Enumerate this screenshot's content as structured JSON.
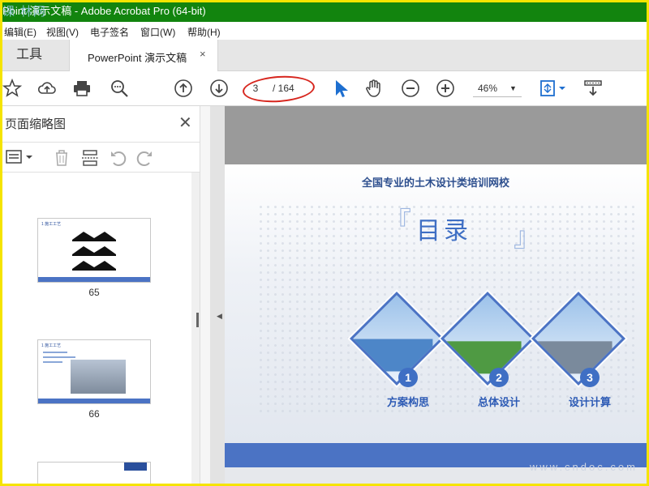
{
  "window": {
    "title": "Point 演示文稿 - Adobe Acrobat Pro (64-bit)",
    "watermark": "课 林网"
  },
  "menu": [
    "编辑(E)",
    "视图(V)",
    "电子签名",
    "窗口(W)",
    "帮助(H)"
  ],
  "tabs": {
    "tools": "工具",
    "document": "PowerPoint 演示文稿",
    "close": "×"
  },
  "toolbar": {
    "current_page": "3",
    "total_pages": "/ 164",
    "zoom": "46%",
    "zoom_arrow": "▼"
  },
  "panel": {
    "title": "页面缩略图",
    "close": "✕",
    "collapse": "◀"
  },
  "thumbnails": [
    {
      "page": "65",
      "heading": "1 施工工艺"
    },
    {
      "page": "66",
      "heading": "1 施工工艺"
    }
  ],
  "slide": {
    "title": "全国专业的土木设计类培训网校",
    "heading": "目录",
    "open_bracket": "『",
    "close_bracket": "』",
    "items": [
      {
        "number": "1",
        "label": "方案构思"
      },
      {
        "number": "2",
        "label": "总体设计"
      },
      {
        "number": "3",
        "label": "设计计算"
      }
    ],
    "watermark": "www.cndoc.com"
  },
  "colors": {
    "titlebar": "#12840e",
    "accent": "#4b73c4",
    "annotation": "#d7261e",
    "frame": "#f5e400"
  }
}
